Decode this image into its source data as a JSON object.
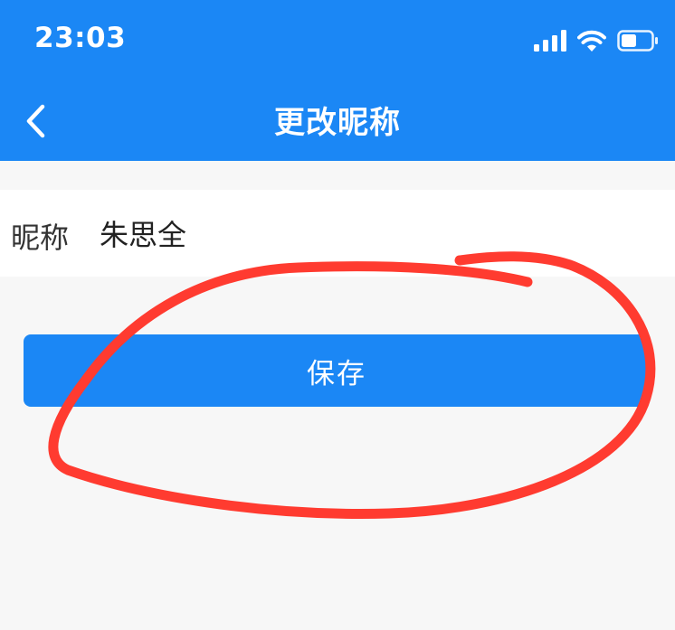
{
  "status_bar": {
    "time": "23:03",
    "icons": [
      "signal-icon",
      "wifi-icon",
      "battery-icon"
    ],
    "battery_level": 0.5
  },
  "nav": {
    "back_icon": "chevron-left-icon",
    "title": "更改昵称"
  },
  "form": {
    "nickname_label": "昵称",
    "nickname_value": "朱思全"
  },
  "actions": {
    "save_label": "保存"
  },
  "colors": {
    "primary": "#1b87f5",
    "background": "#f7f7f7",
    "annotation": "#ff3b30"
  }
}
